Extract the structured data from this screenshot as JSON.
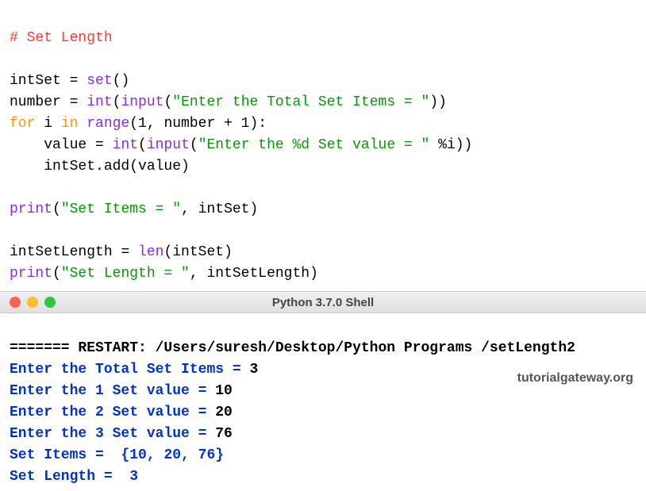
{
  "code": {
    "comment": "# Set Length",
    "l1_var": "intSet ",
    "l1_eq": "= ",
    "l1_set": "set",
    "l1_paren": "()",
    "l2_var": "number ",
    "l2_eq": "= ",
    "l2_int": "int",
    "l2_op": "(",
    "l2_input": "input",
    "l2_op2": "(",
    "l2_str": "\"Enter the Total Set Items = \"",
    "l2_cp": "))",
    "l3_for": "for",
    "l3_mid1": " i ",
    "l3_in": "in",
    "l3_sp": " ",
    "l3_range": "range",
    "l3_args": "(1, number + 1):",
    "l4_indent": "    value ",
    "l4_eq": "= ",
    "l4_int": "int",
    "l4_op": "(",
    "l4_input": "input",
    "l4_op2": "(",
    "l4_str": "\"Enter the %d Set value = \"",
    "l4_post": " %i))",
    "l5": "    intSet.add(value)",
    "l6_print": "print",
    "l6_op": "(",
    "l6_str": "\"Set Items = \"",
    "l6_rest": ", intSet)",
    "l7": "intSetLength ",
    "l7_eq": "= ",
    "l7_len": "len",
    "l7_arg": "(intSet)",
    "l8_print": "print",
    "l8_op": "(",
    "l8_str": "\"Set Length = \"",
    "l8_rest": ", intSetLength)"
  },
  "shell": {
    "title": "Python 3.7.0 Shell",
    "restart": "======= RESTART: /Users/suresh/Desktop/Python Programs /setLength2",
    "p1": "Enter the Total Set Items = ",
    "v1": "3",
    "p2": "Enter the 1 Set value = ",
    "v2": "10",
    "p3": "Enter the 2 Set value = ",
    "v3": "20",
    "p4": "Enter the 3 Set value = ",
    "v4": "76",
    "r1a": "Set Items =  ",
    "r1b": "{10, 20, 76}",
    "r2a": "Set Length =  ",
    "r2b": "3"
  },
  "watermark": "tutorialgateway.org"
}
